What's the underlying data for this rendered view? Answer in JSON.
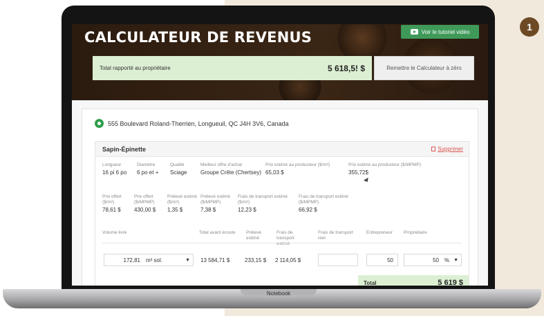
{
  "app": {
    "title": "CALCULATEUR DE REVENUS",
    "video_button": "Voir le tutoriel vidéo",
    "step_number": "1",
    "device_label": "Notebook"
  },
  "summary": {
    "total_label": "Total rapporté au propriétaire",
    "total_value": "5 618,5! $",
    "reset_button": "Remettre le Calculateur à zéro"
  },
  "location": {
    "address": "555 Boulevard Roland-Therrien, Longueuil, QC J4H 3V6, Canada",
    "pin_icon": "map-pin-icon"
  },
  "species": {
    "name": "Sapin-Épinette",
    "delete_label": "Supprimer",
    "row1": [
      {
        "label": "Longueur",
        "value": "16 pi 6 po"
      },
      {
        "label": "Diamètre",
        "value": "6 po et +"
      },
      {
        "label": "Qualité",
        "value": "Sciage"
      },
      {
        "label": "Meilleur offre d'achat",
        "value": "Groupe Crête (Chertsey)"
      },
      {
        "label": "Prix estimé au producteur ($/m³)",
        "value": "65,03 $"
      },
      {
        "label": "Prix estimé au producteur ($/MPMP)",
        "value": "355,72$"
      }
    ],
    "row2": [
      {
        "label": "Prix offert ($/m³)",
        "value": "78,61 $"
      },
      {
        "label": "Prix offert ($/MPMP)",
        "value": "430,00 $"
      },
      {
        "label": "Prélevé estimé ($/m³)",
        "value": "1,35 $"
      },
      {
        "label": "Prélevé estimé ($/MPMP)",
        "value": "7,38 $"
      },
      {
        "label": "Frais de transport estimé ($/m³)",
        "value": "12,23 $"
      },
      {
        "label": "Frais de transport estimé ($/MPMP)",
        "value": "66,92 $"
      }
    ],
    "row3_labels": {
      "volume": "Volume livré",
      "total_before": "Total avant écoute",
      "prelevement": "Prélevé estimé",
      "transport": "Frais de transport estimé",
      "transport_reel": "Frais de transport réel",
      "entrepreneur": "Entrepreneur",
      "proprietaire": "Propriétaire"
    },
    "row3_values": {
      "volume": "172,81",
      "unit": "m³ sol.",
      "total_before": "13 584,71 $",
      "prelevement": "233,15 $",
      "transport": "2 114,05 $",
      "transport_reel": "",
      "entrepreneur": "50",
      "proprietaire": "50",
      "percent": "%"
    },
    "total_label": "Total",
    "total_value": "5 619 $"
  }
}
